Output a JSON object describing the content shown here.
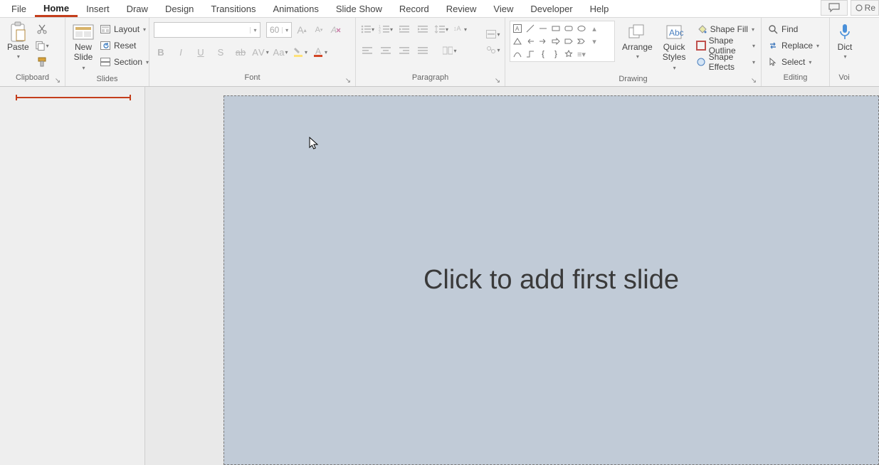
{
  "tabs": [
    "File",
    "Home",
    "Insert",
    "Draw",
    "Design",
    "Transitions",
    "Animations",
    "Slide Show",
    "Record",
    "Review",
    "View",
    "Developer",
    "Help"
  ],
  "active_tab": "Home",
  "topright": {
    "rec_label": "Re"
  },
  "clipboard": {
    "title": "Clipboard",
    "paste": "Paste"
  },
  "slides": {
    "title": "Slides",
    "new_slide_1": "New",
    "new_slide_2": "Slide",
    "layout": "Layout",
    "reset": "Reset",
    "section": "Section"
  },
  "font": {
    "title": "Font",
    "font_name": "",
    "font_size": "60",
    "b": "B",
    "i": "I",
    "u": "U",
    "s": "S",
    "ab": "ab",
    "av": "AV",
    "aa": "Aa"
  },
  "paragraph": {
    "title": "Paragraph"
  },
  "drawing": {
    "title": "Drawing",
    "arrange": "Arrange",
    "quick_styles_1": "Quick",
    "quick_styles_2": "Styles",
    "shape_fill": "Shape Fill",
    "shape_outline": "Shape Outline",
    "shape_effects": "Shape Effects"
  },
  "editing": {
    "title": "Editing",
    "find": "Find",
    "replace": "Replace",
    "select": "Select"
  },
  "voice": {
    "title": "Voi",
    "dictate": "Dict"
  },
  "canvas": {
    "placeholder": "Click to add first slide"
  }
}
